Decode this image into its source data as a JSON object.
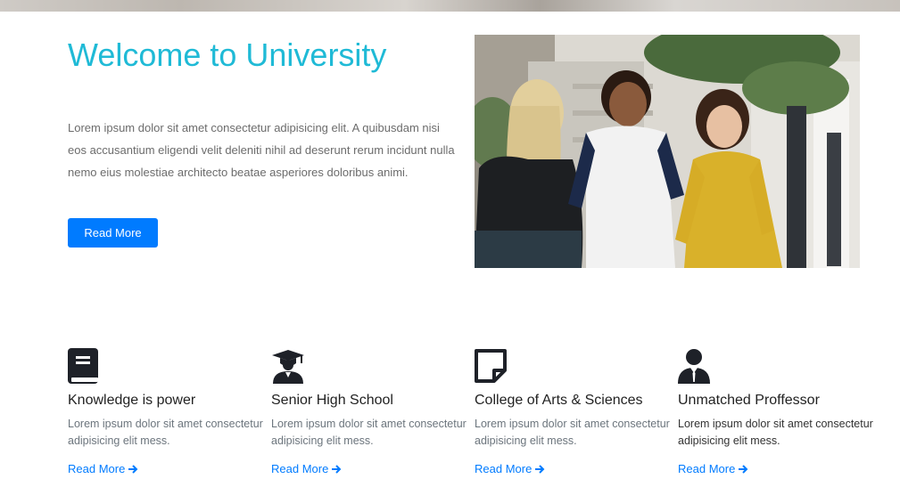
{
  "hero": {
    "title": "Welcome to University",
    "description": "Lorem ipsum dolor sit amet consectetur adipisicing elit. A quibusdam nisi eos accusantium eligendi velit deleniti nihil ad deserunt rerum incidunt nulla nemo eius molestiae architecto beatae asperiores doloribus animi.",
    "button_label": "Read More"
  },
  "features": [
    {
      "icon": "book-icon",
      "title": "Knowledge is power",
      "description": "Lorem ipsum dolor sit amet consectetur adipisicing elit mess.",
      "link": "Read More"
    },
    {
      "icon": "graduate-icon",
      "title": "Senior High School",
      "description": "Lorem ipsum dolor sit amet consectetur adipisicing elit mess.",
      "link": "Read More"
    },
    {
      "icon": "sticky-note-icon",
      "title": "College of Arts & Sciences",
      "description": "Lorem ipsum dolor sit amet consectetur adipisicing elit mess.",
      "link": "Read More"
    },
    {
      "icon": "professor-icon",
      "title": "Unmatched Proffessor",
      "description": "Lorem ipsum dolor sit amet consectetur adipisicing elit mess.",
      "link": "Read More"
    }
  ],
  "colors": {
    "title": "#1fbad6",
    "button": "#007bff",
    "link": "#007bff",
    "icon": "#1e2128"
  }
}
